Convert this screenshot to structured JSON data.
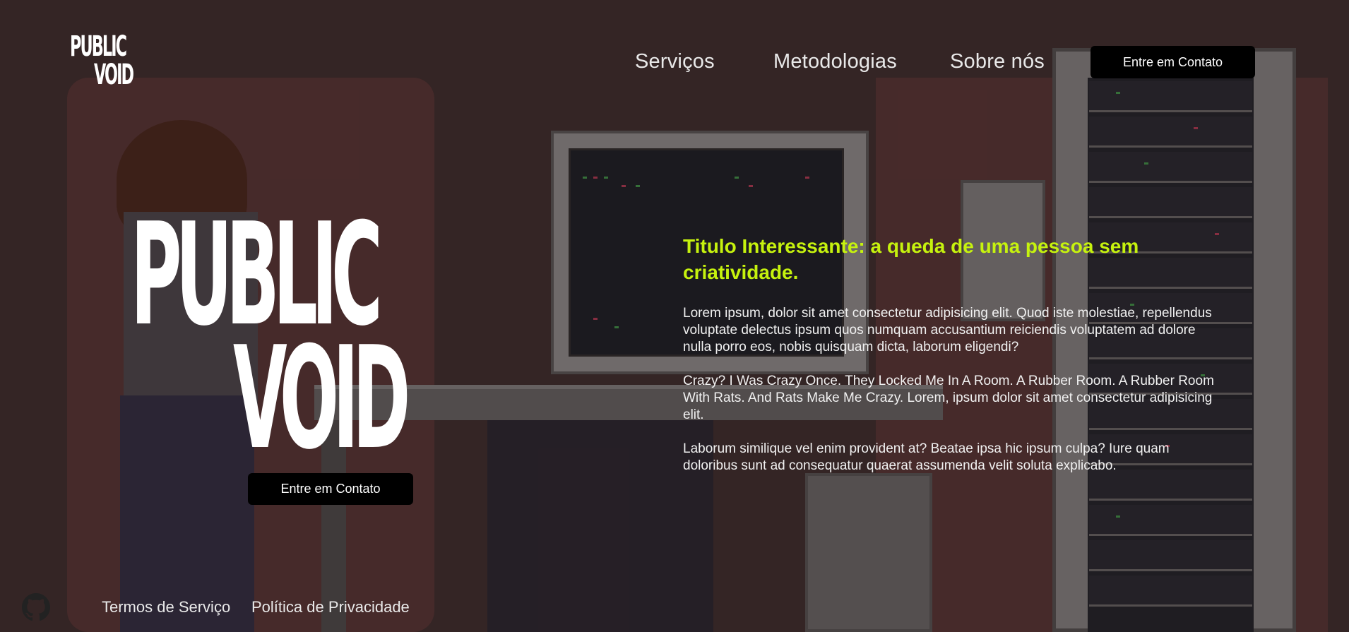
{
  "brand": {
    "logo_line1": "PUBLIC",
    "logo_line2": "VOID",
    "hero_line1": "PUBLIC",
    "hero_line2": "VOID"
  },
  "nav": {
    "items": [
      {
        "label": "Serviços"
      },
      {
        "label": "Metodologias"
      },
      {
        "label": "Sobre nós"
      }
    ],
    "cta_label": "Entre em Contato"
  },
  "hero": {
    "cta_label": "Entre em Contato"
  },
  "content": {
    "headline": "Titulo Interessante: a queda de uma pessoa sem criatividade.",
    "paragraphs": [
      "Lorem ipsum, dolor sit amet consectetur adipisicing elit. Quod iste molestiae, repellendus voluptate delectus ipsum quos numquam accusantium reiciendis voluptatem ad dolore nulla porro eos, nobis quisquam dicta, laborum eligendi?",
      "Crazy? I Was Crazy Once. They Locked Me In A Room. A Rubber Room. A Rubber Room With Rats. And Rats Make Me Crazy. Lorem, ipsum dolor sit amet consectetur adipisicing elit.",
      "Laborum similique vel enim provident at? Beatae ipsa hic ipsum culpa? Iure quam doloribus sunt ad consequatur quaerat assumenda velit soluta explicabo."
    ]
  },
  "footer": {
    "github_icon": "github-icon",
    "links": [
      {
        "label": "Termos de Serviço"
      },
      {
        "label": "Política de Privacidade"
      }
    ]
  },
  "colors": {
    "background": "#3c2c2c",
    "accent": "#c6f20e",
    "button": "#000000"
  }
}
